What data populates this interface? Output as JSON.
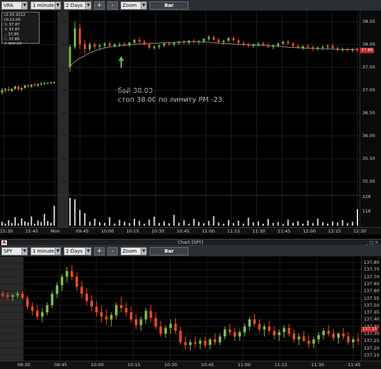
{
  "top_toolbar": {
    "symbol": "VRA",
    "interval": "1 minute",
    "range": "2 Days",
    "zoom_in_label": "+",
    "zoom_out_label": "-",
    "zoom_label": "Zoom",
    "chart_type_label": "Bar"
  },
  "ohlc_box": {
    "datetime": "12.03.2012 10:12:00",
    "open": "O: 37.87",
    "high": "H: 37.87",
    "low": "L: 37.85",
    "close": "C: 37.85",
    "volume": "V: 900.00"
  },
  "annotation": {
    "line1": "бай  38.03",
    "line2": "стоп 38.00 по лимиту PM -23"
  },
  "bottom_window": {
    "title": "Chart [SPY]",
    "title_icon": "A",
    "window_controls": "_ □ ×"
  },
  "bottom_toolbar": {
    "symbol": "SPY",
    "interval": "1 minute",
    "range": "2 Days",
    "zoom_in_label": "+",
    "zoom_out_label": "-",
    "zoom_label": "Zoom",
    "chart_type_label": "Bar"
  },
  "colors": {
    "up": "#7dc242",
    "down": "#ff4a12",
    "ma": "#8a8f94",
    "vol": "#d8d8d8",
    "arrow": "#5cc33c",
    "price_tag": "#c02020"
  },
  "chart_data": [
    {
      "type": "bar",
      "symbol": "VRA",
      "subtype": "candlestick",
      "x_ticks": [
        "15:30",
        "15:45",
        "Mon",
        "09:45",
        "10:00",
        "10:15",
        "10:30",
        "10:45",
        "11:00",
        "11:15",
        "11:30",
        "11:45",
        "12:00",
        "12:15",
        "12:30"
      ],
      "y_ticks": [
        "38.50",
        "38.00",
        "37.50",
        "37.00",
        "36.50",
        "36.00",
        "35.50",
        "35.00"
      ],
      "ylim": [
        34.7,
        38.7
      ],
      "last_price": "37.86",
      "ohlc_series": [
        [
          36.95,
          37.05,
          36.9,
          37.0
        ],
        [
          37.0,
          37.05,
          36.95,
          37.02
        ],
        [
          37.02,
          37.08,
          36.97,
          36.99
        ],
        [
          36.99,
          37.04,
          36.95,
          37.03
        ],
        [
          37.03,
          37.1,
          37.0,
          37.08
        ],
        [
          37.08,
          37.1,
          37.0,
          37.02
        ],
        [
          37.02,
          37.06,
          36.98,
          37.05
        ],
        [
          37.05,
          37.12,
          37.03,
          37.1
        ],
        [
          37.1,
          37.14,
          37.06,
          37.08
        ],
        [
          37.08,
          37.13,
          37.05,
          37.12
        ],
        [
          37.12,
          37.16,
          37.08,
          37.1
        ],
        [
          37.1,
          37.15,
          37.07,
          37.13
        ],
        [
          37.13,
          37.17,
          37.1,
          37.14
        ],
        [
          37.14,
          37.18,
          37.11,
          37.15
        ],
        [
          37.15,
          37.17,
          37.12,
          37.16
        ],
        [
          37.16,
          37.18,
          37.13,
          37.17
        ],
        [
          37.17,
          37.19,
          37.14,
          37.17
        ],
        [
          37.5,
          38.0,
          37.4,
          37.95
        ],
        [
          37.95,
          38.5,
          37.9,
          38.35
        ],
        [
          38.35,
          38.45,
          37.9,
          38.0
        ],
        [
          38.0,
          38.1,
          37.8,
          37.9
        ],
        [
          37.9,
          38.05,
          37.85,
          38.0
        ],
        [
          38.0,
          38.05,
          37.9,
          37.95
        ],
        [
          37.95,
          38.02,
          37.88,
          37.98
        ],
        [
          37.98,
          38.05,
          37.92,
          38.02
        ],
        [
          38.02,
          38.06,
          37.95,
          37.97
        ],
        [
          37.97,
          38.03,
          37.93,
          38.0
        ],
        [
          38.0,
          38.04,
          37.95,
          38.01
        ],
        [
          38.01,
          38.05,
          37.96,
          37.98
        ],
        [
          37.98,
          38.06,
          37.95,
          38.04
        ],
        [
          38.04,
          38.12,
          38.0,
          38.1
        ],
        [
          38.1,
          38.15,
          38.03,
          38.06
        ],
        [
          38.06,
          38.1,
          37.98,
          38.0
        ],
        [
          38.0,
          38.04,
          37.9,
          37.93
        ],
        [
          37.93,
          37.98,
          37.88,
          37.95
        ],
        [
          37.95,
          38.0,
          37.9,
          37.98
        ],
        [
          37.98,
          38.04,
          37.94,
          38.02
        ],
        [
          38.02,
          38.06,
          37.97,
          38.0
        ],
        [
          38.0,
          38.05,
          37.96,
          38.03
        ],
        [
          38.03,
          38.08,
          37.99,
          38.05
        ],
        [
          38.05,
          38.09,
          38.0,
          38.04
        ],
        [
          38.04,
          38.1,
          38.0,
          38.08
        ],
        [
          38.08,
          38.12,
          38.02,
          38.05
        ],
        [
          38.05,
          38.1,
          38.0,
          38.07
        ],
        [
          38.07,
          38.14,
          38.03,
          38.12
        ],
        [
          38.12,
          38.2,
          38.08,
          38.16
        ],
        [
          38.16,
          38.2,
          38.08,
          38.1
        ],
        [
          38.1,
          38.14,
          38.02,
          38.05
        ],
        [
          38.05,
          38.1,
          38.0,
          38.08
        ],
        [
          38.08,
          38.16,
          38.05,
          38.14
        ],
        [
          38.14,
          38.18,
          38.06,
          38.09
        ],
        [
          38.09,
          38.12,
          38.0,
          38.03
        ],
        [
          38.03,
          38.07,
          37.97,
          38.0
        ],
        [
          38.0,
          38.04,
          37.94,
          37.97
        ],
        [
          37.97,
          38.02,
          37.92,
          38.0
        ],
        [
          38.0,
          38.05,
          37.95,
          38.02
        ],
        [
          38.02,
          38.06,
          37.96,
          37.99
        ],
        [
          37.99,
          38.03,
          37.92,
          37.95
        ],
        [
          37.95,
          38.0,
          37.9,
          37.98
        ],
        [
          37.98,
          38.04,
          37.94,
          38.02
        ],
        [
          38.02,
          38.08,
          37.99,
          38.06
        ],
        [
          38.06,
          38.1,
          38.0,
          38.02
        ],
        [
          38.02,
          38.05,
          37.94,
          37.97
        ],
        [
          37.97,
          38.0,
          37.9,
          37.93
        ],
        [
          37.93,
          37.98,
          37.88,
          37.96
        ],
        [
          37.96,
          38.0,
          37.9,
          37.94
        ],
        [
          37.94,
          37.98,
          37.86,
          37.9
        ],
        [
          37.9,
          37.96,
          37.86,
          37.93
        ],
        [
          37.93,
          37.98,
          37.88,
          37.95
        ],
        [
          37.95,
          38.0,
          37.9,
          37.97
        ],
        [
          37.97,
          38.01,
          37.9,
          37.92
        ],
        [
          37.92,
          37.96,
          37.85,
          37.88
        ],
        [
          37.88,
          37.93,
          37.84,
          37.9
        ],
        [
          37.9,
          37.94,
          37.85,
          37.87
        ],
        [
          37.87,
          37.92,
          37.83,
          37.89
        ],
        [
          37.89,
          37.93,
          37.84,
          37.86
        ]
      ],
      "volume_ticks": [
        "22K",
        "11K"
      ],
      "volume_range": [
        0,
        22000
      ],
      "volumes": [
        3000,
        1500,
        4200,
        2000,
        6500,
        1800,
        5500,
        3300,
        2400,
        7000,
        1500,
        4000,
        2800,
        9000,
        3500,
        2200,
        15000,
        21000,
        20000,
        12000,
        9500,
        3000,
        5200,
        2600,
        2100,
        6300,
        1700,
        4400,
        3100,
        2000,
        5200,
        3600,
        1500,
        4700,
        6800,
        2100,
        3300,
        1900,
        8200,
        2300,
        4100,
        1500,
        5000,
        2800,
        1900,
        3600,
        7200,
        2400,
        1500,
        4300,
        2000,
        3800,
        1600,
        6000,
        2500,
        3300,
        1500,
        5100,
        2100,
        2800,
        1400,
        4600,
        2200,
        3500,
        1600,
        3900,
        2000,
        5400,
        2600,
        1600,
        3100,
        2400,
        4200,
        2000,
        3000,
        12500
      ],
      "moving_average": [
        37.5,
        37.6,
        37.68,
        37.74,
        37.8,
        37.85,
        37.89,
        37.92,
        37.94,
        37.96,
        37.97,
        37.98,
        37.99,
        38.0,
        38.01,
        38.01,
        38.02,
        38.03,
        38.03,
        38.04,
        38.04,
        38.04,
        38.05,
        38.06,
        38.06,
        38.06,
        38.06,
        38.05,
        38.05,
        38.04,
        38.03,
        38.02,
        38.02,
        38.01,
        38.0,
        38.0,
        37.99,
        37.99,
        37.98,
        37.98,
        37.97,
        37.97,
        37.96,
        37.95,
        37.94,
        37.93,
        37.93,
        37.92,
        37.92,
        37.91,
        37.91,
        37.9,
        37.9,
        37.9,
        37.89,
        37.89,
        37.89,
        37.89,
        37.9
      ]
    },
    {
      "type": "bar",
      "symbol": "SPY",
      "subtype": "candlestick",
      "x_ticks": [
        "09:30",
        "09:45",
        "10:00",
        "10:15",
        "10:30",
        "10:45",
        "11:00",
        "11:15",
        "11:30",
        "11:45"
      ],
      "y_ticks": [
        "137.80",
        "137.75",
        "137.70",
        "137.65",
        "137.60",
        "137.55",
        "137.50",
        "137.45",
        "137.40",
        "137.35",
        "137.30",
        "137.25",
        "137.20",
        "137.15"
      ],
      "ylim": [
        137.12,
        137.83
      ],
      "last_price": "137.33",
      "ohlc_series": [
        [
          137.58,
          137.6,
          137.55,
          137.57
        ],
        [
          137.57,
          137.59,
          137.54,
          137.56
        ],
        [
          137.56,
          137.58,
          137.53,
          137.57
        ],
        [
          137.57,
          137.6,
          137.55,
          137.58
        ],
        [
          137.58,
          137.6,
          137.54,
          137.55
        ],
        [
          137.55,
          137.57,
          137.47,
          137.49
        ],
        [
          137.49,
          137.52,
          137.43,
          137.46
        ],
        [
          137.46,
          137.5,
          137.4,
          137.42
        ],
        [
          137.42,
          137.48,
          137.38,
          137.45
        ],
        [
          137.45,
          137.52,
          137.43,
          137.5
        ],
        [
          137.5,
          137.6,
          137.48,
          137.58
        ],
        [
          137.58,
          137.66,
          137.55,
          137.64
        ],
        [
          137.64,
          137.72,
          137.6,
          137.7
        ],
        [
          137.7,
          137.77,
          137.66,
          137.74
        ],
        [
          137.74,
          137.78,
          137.68,
          137.7
        ],
        [
          137.7,
          137.73,
          137.6,
          137.63
        ],
        [
          137.63,
          137.67,
          137.55,
          137.58
        ],
        [
          137.58,
          137.62,
          137.5,
          137.53
        ],
        [
          137.53,
          137.57,
          137.46,
          137.49
        ],
        [
          137.49,
          137.53,
          137.42,
          137.45
        ],
        [
          137.45,
          137.5,
          137.38,
          137.42
        ],
        [
          137.42,
          137.47,
          137.36,
          137.4
        ],
        [
          137.4,
          137.45,
          137.35,
          137.43
        ],
        [
          137.43,
          137.52,
          137.4,
          137.5
        ],
        [
          137.5,
          137.56,
          137.45,
          137.48
        ],
        [
          137.48,
          137.52,
          137.42,
          137.45
        ],
        [
          137.45,
          137.49,
          137.38,
          137.4
        ],
        [
          137.4,
          137.44,
          137.33,
          137.36
        ],
        [
          137.36,
          137.42,
          137.32,
          137.4
        ],
        [
          137.4,
          137.48,
          137.37,
          137.46
        ],
        [
          137.46,
          137.5,
          137.38,
          137.41
        ],
        [
          137.41,
          137.45,
          137.33,
          137.35
        ],
        [
          137.35,
          137.39,
          137.28,
          137.3
        ],
        [
          137.3,
          137.36,
          137.27,
          137.34
        ],
        [
          137.34,
          137.4,
          137.3,
          137.37
        ],
        [
          137.37,
          137.41,
          137.3,
          137.32
        ],
        [
          137.32,
          137.35,
          137.22,
          137.24
        ],
        [
          137.24,
          137.28,
          137.19,
          137.22
        ],
        [
          137.22,
          137.26,
          137.18,
          137.24
        ],
        [
          137.24,
          137.28,
          137.2,
          137.23
        ],
        [
          137.23,
          137.27,
          137.19,
          137.25
        ],
        [
          137.25,
          137.28,
          137.2,
          137.22
        ],
        [
          137.22,
          137.27,
          137.19,
          137.26
        ],
        [
          137.26,
          137.3,
          137.22,
          137.24
        ],
        [
          137.24,
          137.3,
          137.22,
          137.28
        ],
        [
          137.28,
          137.35,
          137.26,
          137.33
        ],
        [
          137.33,
          137.37,
          137.29,
          137.31
        ],
        [
          137.31,
          137.34,
          137.25,
          137.28
        ],
        [
          137.28,
          137.33,
          137.25,
          137.31
        ],
        [
          137.31,
          137.37,
          137.28,
          137.35
        ],
        [
          137.35,
          137.42,
          137.32,
          137.4
        ],
        [
          137.4,
          137.44,
          137.35,
          137.37
        ],
        [
          137.37,
          137.4,
          137.31,
          137.33
        ],
        [
          137.33,
          137.37,
          137.28,
          137.35
        ],
        [
          137.35,
          137.39,
          137.3,
          137.32
        ],
        [
          137.32,
          137.35,
          137.26,
          137.29
        ],
        [
          137.29,
          137.33,
          137.25,
          137.31
        ],
        [
          137.31,
          137.36,
          137.27,
          137.34
        ],
        [
          137.34,
          137.37,
          137.28,
          137.3
        ],
        [
          137.3,
          137.33,
          137.24,
          137.26
        ],
        [
          137.26,
          137.3,
          137.22,
          137.28
        ],
        [
          137.28,
          137.32,
          137.24,
          137.25
        ],
        [
          137.25,
          137.29,
          137.2,
          137.23
        ],
        [
          137.23,
          137.28,
          137.2,
          137.26
        ],
        [
          137.26,
          137.31,
          137.23,
          137.29
        ],
        [
          137.29,
          137.34,
          137.26,
          137.32
        ],
        [
          137.32,
          137.36,
          137.28,
          137.3
        ],
        [
          137.3,
          137.33,
          137.25,
          137.27
        ],
        [
          137.27,
          137.31,
          137.23,
          137.3
        ],
        [
          137.3,
          137.34,
          137.26,
          137.28
        ],
        [
          137.28,
          137.31,
          137.22,
          137.24
        ],
        [
          137.24,
          137.28,
          137.2,
          137.26
        ],
        [
          137.26,
          137.3,
          137.22,
          137.25
        ]
      ]
    }
  ]
}
